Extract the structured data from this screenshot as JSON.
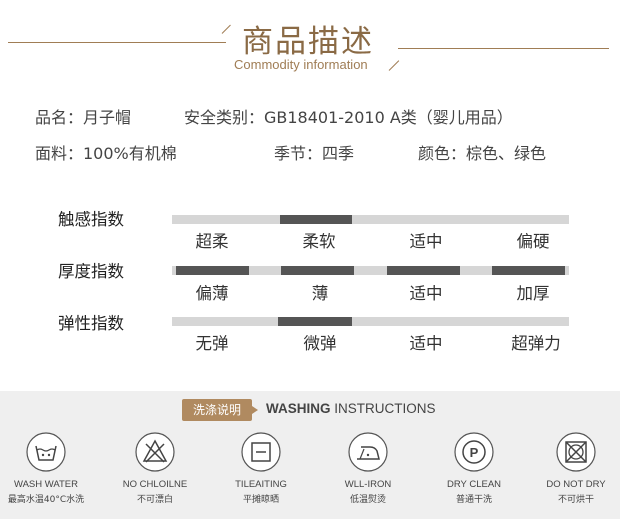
{
  "header": {
    "title": "商品描述",
    "subtitle": "Commodity information"
  },
  "info": {
    "name": "品名：月子帽",
    "safety": "安全类别：GB18401-2010 A类（婴儿用品）",
    "material": "面料：100%有机棉",
    "season": "季节：四季",
    "color": "颜色：棕色、绿色"
  },
  "indices": [
    {
      "label": "触感指数",
      "options": [
        "超柔",
        "柔软",
        "适中",
        "偏硬"
      ],
      "selected": "柔软"
    },
    {
      "label": "厚度指数",
      "options": [
        "偏薄",
        "薄",
        "适中",
        "加厚"
      ],
      "selected": "all"
    },
    {
      "label": "弹性指数",
      "options": [
        "无弹",
        "微弹",
        "适中",
        "超弹力"
      ],
      "selected": "微弹"
    }
  ],
  "washing": {
    "badge": "洗涤说明",
    "title_bold": "WASHING",
    "title_rest": " INSTRUCTIONS",
    "items": [
      {
        "en": "WASH WATER",
        "cn": "最高水温40°C水洗",
        "icon": "wash-water-icon"
      },
      {
        "en": "NO CHLOILNE",
        "cn": "不可漂白",
        "icon": "no-bleach-icon"
      },
      {
        "en": "TILEAITING",
        "cn": "平摊晾晒",
        "icon": "flat-dry-icon"
      },
      {
        "en": "WLL-IRON",
        "cn": "低温熨烫",
        "icon": "iron-icon"
      },
      {
        "en": "DRY CLEAN",
        "cn": "普通干洗",
        "icon": "dry-clean-icon"
      },
      {
        "en": "DO NOT DRY",
        "cn": "不可烘干",
        "icon": "no-tumble-dry-icon"
      }
    ]
  },
  "colors": {
    "accent": "#a07d55",
    "bar": "#555555",
    "track": "#d6d6d6",
    "wash_bg": "#efefef"
  }
}
